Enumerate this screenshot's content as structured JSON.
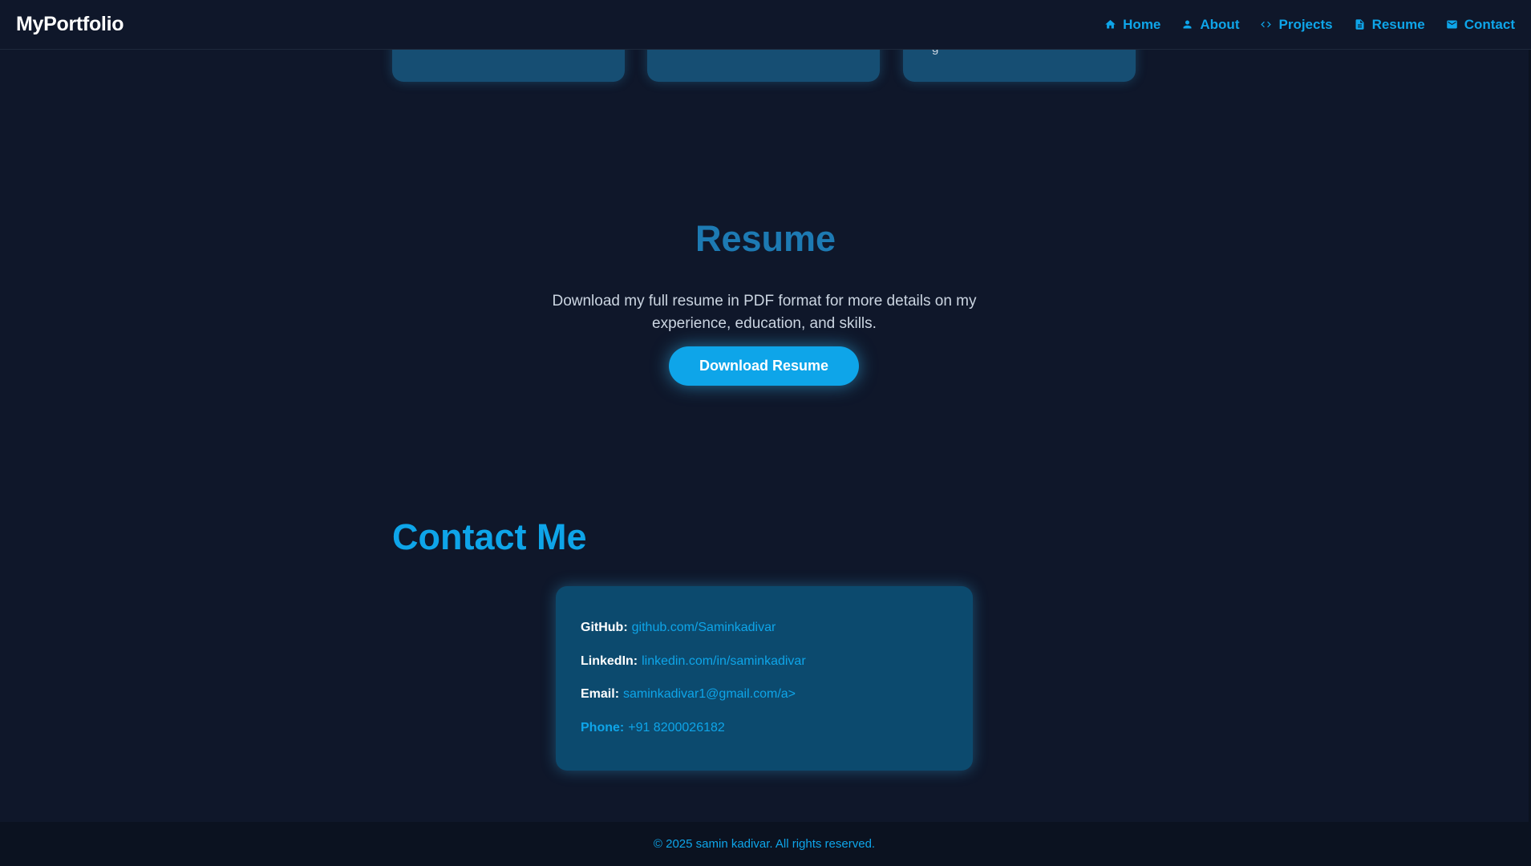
{
  "nav": {
    "brand": "MyPortfolio",
    "items": [
      {
        "label": "Home",
        "icon": "home-icon"
      },
      {
        "label": "About",
        "icon": "user-icon"
      },
      {
        "label": "Projects",
        "icon": "code-icon"
      },
      {
        "label": "Resume",
        "icon": "document-icon"
      },
      {
        "label": "Contact",
        "icon": "mail-icon"
      }
    ]
  },
  "projects": {
    "card_snippet": "g"
  },
  "resume": {
    "title": "Resume",
    "description": "Download my full resume in PDF format for more details on my experience, education, and skills.",
    "button_label": "Download Resume"
  },
  "contact": {
    "title": "Contact Me",
    "github": {
      "label": "GitHub:",
      "value": "github.com/Saminkadivar"
    },
    "linkedin": {
      "label": "LinkedIn:",
      "value": "linkedin.com/in/saminkadivar"
    },
    "email": {
      "label": "Email:",
      "value": "saminkadivar1@gmail.com/a>"
    },
    "phone": {
      "label": "Phone:",
      "value": "+91 8200026182"
    }
  },
  "footer": {
    "text": "© 2025 samin kadivar. All rights reserved."
  },
  "colors": {
    "background": "#0f172a",
    "accent": "#0ea5e9",
    "card": "#164e73",
    "contact_card": "#0c4a6e"
  }
}
